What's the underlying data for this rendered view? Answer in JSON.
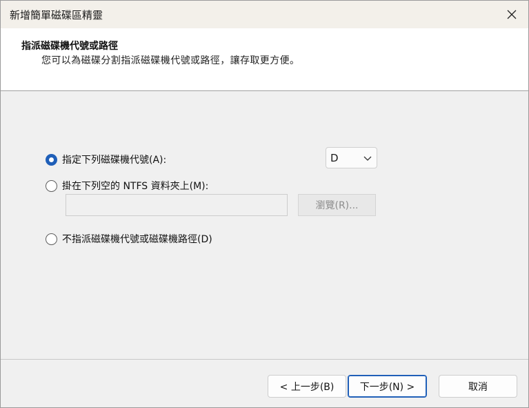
{
  "window": {
    "title": "新增簡單磁碟區精靈"
  },
  "header": {
    "title": "指派磁碟機代號或路徑",
    "subtitle": "您可以為磁碟分割指派磁碟機代號或路徑，讓存取更方便。"
  },
  "options": {
    "assign_letter": {
      "label": "指定下列磁碟機代號(A):",
      "selected": true
    },
    "mount_folder": {
      "label": "掛在下列空的 NTFS 資料夾上(M):",
      "selected": false
    },
    "none": {
      "label": "不指派磁碟機代號或磁碟機路徑(D)",
      "selected": false
    }
  },
  "drive_letter": {
    "value": "D"
  },
  "folder_path": {
    "value": ""
  },
  "browse_button": {
    "label": "瀏覽(R)...",
    "enabled": false
  },
  "footer": {
    "back_label": "< 上一步(B)",
    "next_label": "下一步(N) >",
    "cancel_label": "取消"
  },
  "colors": {
    "accent": "#1f5fb8",
    "window_bg": "#f0f0f0",
    "header_bg": "#ffffff",
    "titlebar_bg": "#f3f0ea"
  },
  "icons": {
    "close": "close-icon",
    "dropdown": "chevron-down-icon"
  }
}
